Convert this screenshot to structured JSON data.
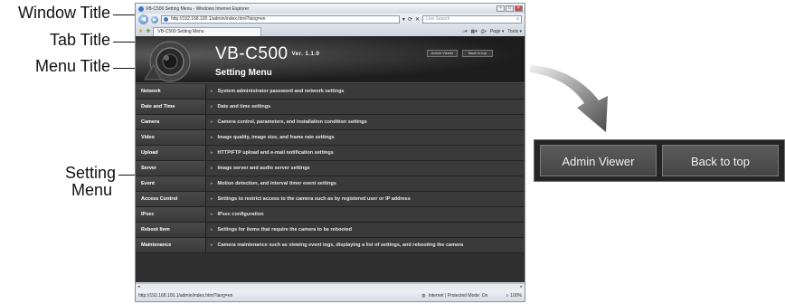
{
  "callouts": {
    "window_title": "Window Title",
    "tab_title": "Tab Title",
    "menu_title": "Menu Title",
    "setting_menu_line1": "Setting",
    "setting_menu_line2": "Menu"
  },
  "browser": {
    "window_title": "VB-C500 Setting Menu - Windows Internet Explorer",
    "address": "http://192.168.100.1/admin/index.html?lang=en",
    "live_search_placeholder": "Live Search",
    "tab_title": "VB-C500 Setting Menu",
    "command_bar": [
      "Page ▾",
      "Tools ▾"
    ],
    "status_url": "http://192.168.100.1/admin/index.html?lang=en",
    "status_zone": "Internet | Protected Mode: On",
    "zoom": "100%"
  },
  "page": {
    "product": "VB-C500",
    "version": "Ver. 1.1.0",
    "menu_title": "Setting Menu",
    "header_buttons": [
      "Admin Viewer",
      "Back to top"
    ],
    "menu": [
      {
        "name": "Network",
        "desc": "System administrator password and network settings"
      },
      {
        "name": "Date and Time",
        "desc": "Date and time settings"
      },
      {
        "name": "Camera",
        "desc": "Camera control, parameters, and installation condition settings"
      },
      {
        "name": "Video",
        "desc": "Image quality, image size, and frame rate settings"
      },
      {
        "name": "Upload",
        "desc": "HTTP/FTP upload and e-mail notification settings"
      },
      {
        "name": "Server",
        "desc": "Image server and audio server settings"
      },
      {
        "name": "Event",
        "desc": "Motion detection, and interval timer event settings"
      },
      {
        "name": "Access Control",
        "desc": "Settings to restrict access to the camera such as by registered user or IP address"
      },
      {
        "name": "IPsec",
        "desc": "IPsec configuration"
      },
      {
        "name": "Reboot Item",
        "desc": "Settings for items that require the camera to be rebooted"
      },
      {
        "name": "Maintenance",
        "desc": "Camera maintenance such as viewing event logs, displaying a list of settings, and rebooting the camera"
      }
    ]
  },
  "zoomed": {
    "admin_viewer": "Admin Viewer",
    "back_to_top": "Back to top"
  }
}
